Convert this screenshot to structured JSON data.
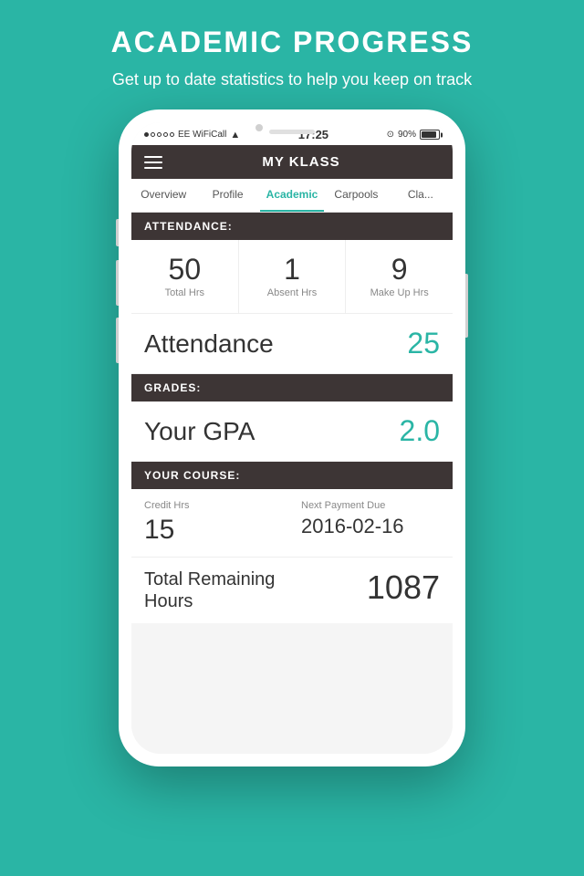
{
  "page": {
    "background_color": "#2ab5a5",
    "header": {
      "title": "ACADEMIC PROGRESS",
      "subtitle": "Get up to date statistics to help you keep on track"
    }
  },
  "phone": {
    "status_bar": {
      "carrier": "●○○○○ EE WiFiCall",
      "wifi": "WiFiCall",
      "time": "17:25",
      "battery_icon": "⊙",
      "battery_percent": "90%"
    },
    "navbar": {
      "title": "MY KLASS",
      "hamburger_icon": "≡"
    },
    "tabs": [
      {
        "label": "Overview",
        "active": false
      },
      {
        "label": "Profile",
        "active": false
      },
      {
        "label": "Academic",
        "active": true
      },
      {
        "label": "Carpools",
        "active": false
      },
      {
        "label": "Cla...",
        "active": false
      }
    ],
    "content": {
      "attendance_section": {
        "header": "ATTENDANCE:",
        "stats": [
          {
            "value": "50",
            "label": "Total Hrs"
          },
          {
            "value": "1",
            "label": "Absent Hrs"
          },
          {
            "value": "9",
            "label": "Make Up Hrs"
          }
        ]
      },
      "attendance_score": {
        "label": "Attendance",
        "value": "25"
      },
      "grades_section": {
        "header": "GRADES:",
        "gpa_label": "Your GPA",
        "gpa_value": "2.0"
      },
      "course_section": {
        "header": "YOUR COURSE:",
        "credit_hrs_label": "Credit Hrs",
        "credit_hrs_value": "15",
        "next_payment_label": "Next Payment Due",
        "next_payment_value": "2016-02-16"
      },
      "total_remaining": {
        "label": "Total Remaining\nHours",
        "value": "1087"
      }
    }
  }
}
